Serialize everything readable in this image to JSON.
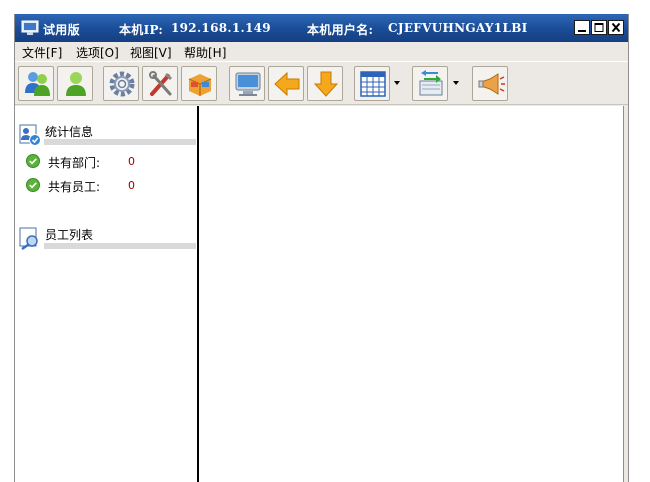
{
  "title_bar": {
    "app_name": "试用版",
    "ip_label": "本机IP:",
    "ip_value": "192.168.1.149",
    "user_label": "本机用户名:",
    "user_value": "CJEFVUHNGAY1LBI"
  },
  "menu": {
    "items": [
      {
        "label": "文件[F]"
      },
      {
        "label": "选项[O]"
      },
      {
        "label": "视图[V]"
      },
      {
        "label": "帮助[H]"
      }
    ]
  },
  "toolbar": {
    "buttons": [
      {
        "icon": "users-add-icon"
      },
      {
        "icon": "user-icon"
      },
      {
        "icon": "gear-icon"
      },
      {
        "icon": "tools-icon"
      },
      {
        "icon": "package-icon"
      },
      {
        "icon": "monitor-icon"
      },
      {
        "icon": "arrow-left-icon"
      },
      {
        "icon": "arrow-down-icon"
      },
      {
        "icon": "calendar-grid-icon"
      },
      {
        "icon": "transfer-icon"
      },
      {
        "icon": "megaphone-icon"
      }
    ]
  },
  "left_panel": {
    "stats_section": {
      "title": "统计信息",
      "items": [
        {
          "label": "共有部门:",
          "value": "0"
        },
        {
          "label": "共有员工:",
          "value": "0"
        }
      ]
    },
    "employee_section": {
      "title": "员工列表"
    }
  }
}
